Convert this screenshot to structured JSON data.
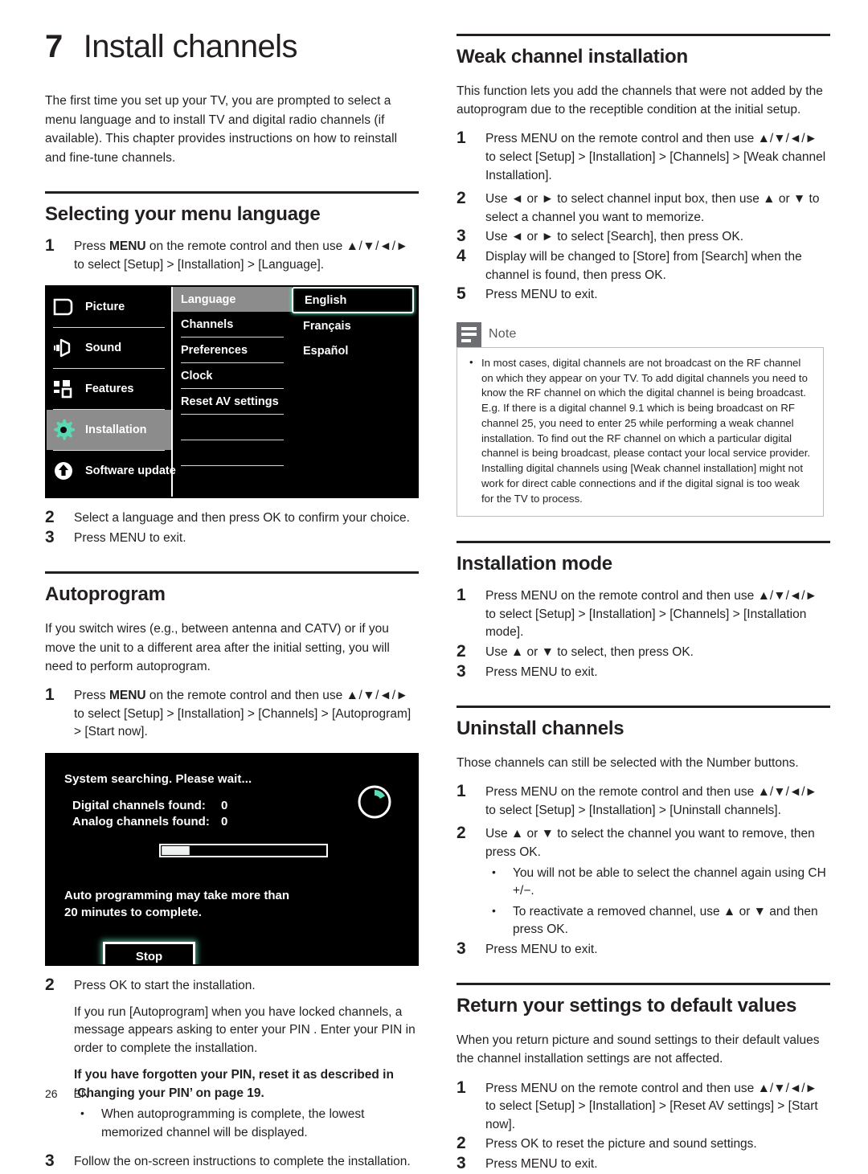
{
  "chapter": {
    "number": "7",
    "title": "Install channels",
    "intro": "The first time you set up your TV, you are prompted to select a menu language and to install TV and digital radio channels (if available). This chapter provides instructions on how to reinstall and fine-tune channels."
  },
  "menu_language": {
    "heading": "Selecting your menu language",
    "step1_a": "Press ",
    "step1_menu": "MENU",
    "step1_b": " on the remote control and then use ",
    "step1_arrows": "▲/▼/◄/►",
    "step1_c": " to select [Setup] > [Installation] > [Language].",
    "step2": "Select a language and then press OK to confirm your choice.",
    "step3": "Press MENU to exit."
  },
  "tv_menu": {
    "sidebar": [
      {
        "label": "Picture",
        "icon": "picture-icon",
        "selected": false
      },
      {
        "label": "Sound",
        "icon": "speaker-icon",
        "selected": false
      },
      {
        "label": "Features",
        "icon": "grid-icon",
        "selected": false
      },
      {
        "label": "Installation",
        "icon": "gear-icon",
        "selected": true
      },
      {
        "label": "Software update",
        "icon": "up-arrow-circle-icon",
        "selected": false
      }
    ],
    "middle": [
      {
        "label": "Language",
        "selected": true
      },
      {
        "label": "Channels",
        "selected": false
      },
      {
        "label": "Preferences",
        "selected": false
      },
      {
        "label": "Clock",
        "selected": false
      },
      {
        "label": "Reset AV settings",
        "selected": false
      }
    ],
    "right": [
      {
        "label": "English",
        "selected": true
      },
      {
        "label": "Français",
        "selected": false
      },
      {
        "label": "Español",
        "selected": false
      }
    ],
    "accent_color": "#5ad9b4",
    "selected_bg": "#8c8c8c"
  },
  "autoprogram": {
    "heading": "Autoprogram",
    "intro": "If you switch wires (e.g., between antenna and CATV) or if you move the unit to a different area after the initial setting, you will need to perform autoprogram.",
    "step1_a": "Press ",
    "step1_menu": "MENU",
    "step1_b": " on the remote control and then use ",
    "step1_arrows": "▲/▼/◄/►",
    "step1_c": " to select [Setup] > [Installation] > [Channels] > [Autoprogram] > [Start now].",
    "step2": "Press OK to start the installation.",
    "step2_note1": "If you run [Autoprogram] when you have locked channels, a message appears asking to enter your PIN . Enter your PIN in order to complete the installation.",
    "step2_note2": "If you have forgotten your PIN, reset it as described in ‘Changing your PIN’ on page 19.",
    "step2_bullet": "When autoprogramming is complete, the lowest memorized channel will be displayed.",
    "step3": "Follow the on-screen instructions to complete the installation."
  },
  "search_screen": {
    "title": "System searching. Please wait...",
    "digital_label": "Digital channels found:",
    "digital_value": "0",
    "analog_label": "Analog channels found:",
    "analog_value": "0",
    "progress_percent": 17,
    "note_line1": "Auto programming may take more than",
    "note_line2": "20 minutes to complete.",
    "stop_button": "Stop",
    "spinner": "loading-spinner-icon"
  },
  "weak_channel": {
    "heading": "Weak channel installation",
    "intro": "This function lets you add the channels that were not added by the autoprogram due to the receptible condition at the initial setup.",
    "step1": "Press MENU on the remote control and then use ▲/▼/◄/► to select [Setup] > [Installation] > [Channels] > [Weak channel Installation].",
    "step2": "Use ◄ or ► to select channel input box, then use ▲ or ▼ to select a channel you want to memorize.",
    "step3": "Use ◄ or ► to select [Search], then press OK.",
    "step4": "Display will be changed to [Store] from [Search] when the channel is found, then press OK.",
    "step5": "Press MENU to exit."
  },
  "note": {
    "icon": "note-icon",
    "title": "Note",
    "paragraph1": "In most cases, digital channels are not broadcast on the RF channel on which they appear on your TV. To add digital channels you need to know the RF channel on which the digital channel is being broadcast. E.g. If there is a digital channel 9.1 which is being broadcast on RF channel 25, you need to enter 25 while performing a weak channel installation. To find out the RF channel on which a particular digital channel is being broadcast, please contact your local service provider.",
    "paragraph2": "Installing digital channels using [Weak channel installation] might not work for direct cable connections and if the digital signal is too weak for the TV to process."
  },
  "installation_mode": {
    "heading": "Installation mode",
    "step1": "Press MENU on the remote control and then use ▲/▼/◄/► to select [Setup] > [Installation] > [Channels] > [Installation mode].",
    "step2": "Use ▲ or ▼ to select, then press OK.",
    "step3": "Press MENU to exit."
  },
  "uninstall": {
    "heading": "Uninstall channels",
    "intro": "Those channels can still be selected with the Number buttons.",
    "step1": "Press MENU on the remote control and then use ▲/▼/◄/► to select [Setup] > [Installation] > [Uninstall channels].",
    "step2": "Use ▲ or ▼ to select the channel you want to remove, then press OK.",
    "step2_bullet1": "You will not be able to select the channel again using CH +/−.",
    "step2_bullet2": "To reactivate a removed channel, use ▲ or ▼ and then press OK.",
    "step3": "Press MENU to exit."
  },
  "reset_defaults": {
    "heading": "Return your settings to default values",
    "intro": "When you return picture and sound settings to their default values the channel installation settings are not affected.",
    "step1": "Press MENU on the remote control and then use ▲/▼/◄/► to select [Setup] > [Installation] > [Reset AV settings] > [Start now].",
    "step2": "Press OK to reset the picture and sound settings.",
    "step3": "Press MENU to exit."
  },
  "footer": {
    "page_number": "26",
    "language_code": "EN"
  }
}
